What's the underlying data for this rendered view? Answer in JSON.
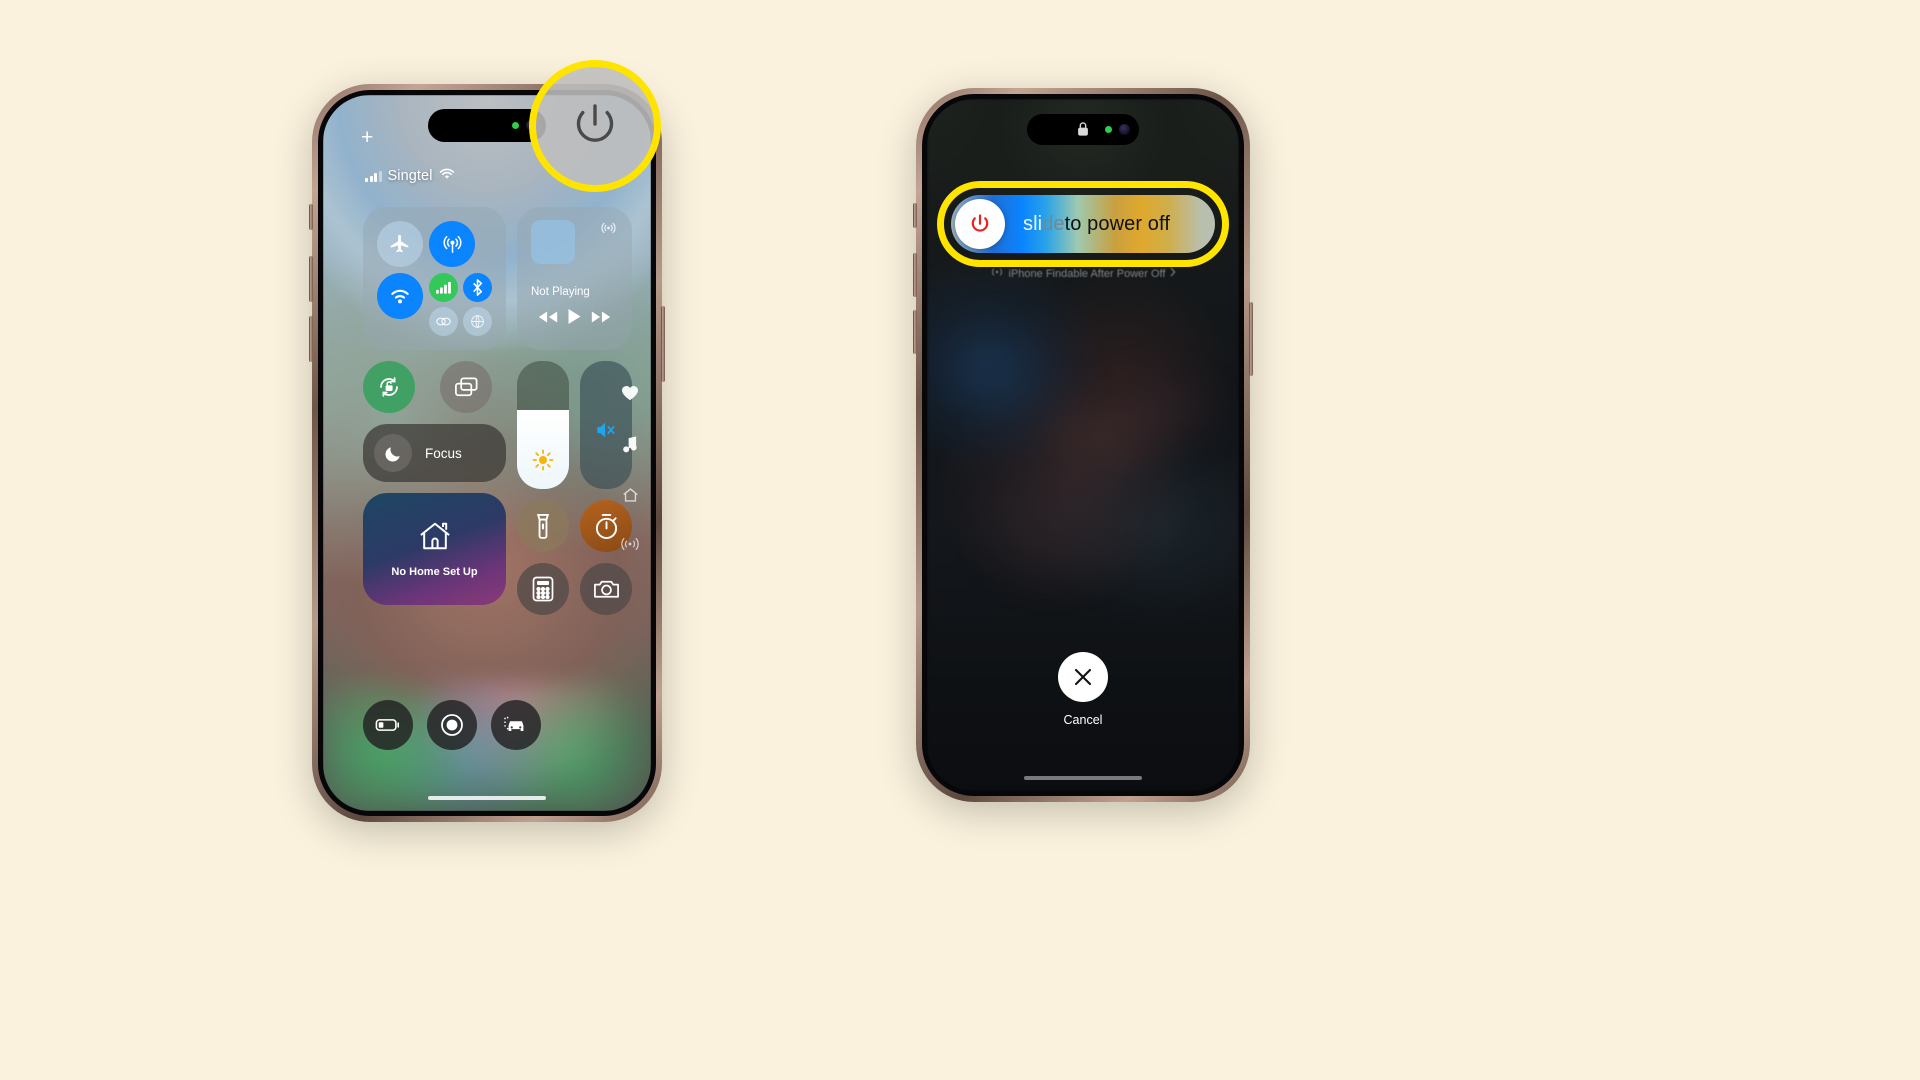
{
  "background_color": "#faf2dd",
  "highlight_color": "#ffe400",
  "phone1": {
    "name": "iphone-control-center",
    "status_bar": {
      "carrier": "Singtel",
      "signal_icon": "cellular-bars-icon",
      "wifi_icon": "wifi-icon"
    },
    "add_widget_icon": "plus-icon",
    "connectivity": {
      "airplane_label": "airplane-mode-toggle",
      "airdrop_label": "airdrop-toggle",
      "wifi_label": "wifi-toggle",
      "cellular_label": "cellular-data-toggle",
      "bluetooth_label": "bluetooth-toggle",
      "vpn_label": "vpn-toggle",
      "hotspot_label": "personal-hotspot-toggle",
      "airplane_active": false,
      "airdrop_active": true,
      "wifi_active": true,
      "cellular_active": true,
      "bluetooth_active": true
    },
    "media": {
      "title": "Not Playing",
      "rewind_icon": "rewind-icon",
      "play_icon": "play-icon",
      "forward_icon": "fast-forward-icon"
    },
    "rotation_lock_label": "rotation-lock-toggle",
    "screen_mirroring_label": "screen-mirroring-button",
    "focus": {
      "label": "Focus",
      "icon": "moon-icon"
    },
    "home": {
      "label": "No Home Set Up",
      "icon": "house-icon"
    },
    "brightness": {
      "icon": "sun-icon",
      "level_percent": 62
    },
    "volume": {
      "icon": "speaker-mute-icon",
      "level_percent": 0
    },
    "shortcuts": {
      "flashlight": "flashlight-icon",
      "timer": "timer-icon",
      "calculator": "calculator-icon",
      "camera": "camera-icon"
    },
    "bottom_row": {
      "low_power": "battery-low-power-icon",
      "screen_record": "screen-record-icon",
      "car": "car-parking-icon"
    },
    "right_rail": {
      "heart": "heart-icon",
      "music": "music-note-icon",
      "home": "home-small-icon",
      "broadcast": "broadcast-icon"
    },
    "power_button_highlight": "power-button-highlight"
  },
  "phone2": {
    "name": "iphone-power-off-screen",
    "lock_icon": "lock-icon",
    "slider": {
      "text_parts": [
        "sli",
        "de",
        " to power off"
      ],
      "full_text": "slide to power off",
      "knob_icon": "power-icon",
      "knob_icon_color": "#e8221f"
    },
    "findable_text": "iPhone Findable After Power Off",
    "findable_icon": "findmy-waves-icon",
    "findable_chevron": "chevron-right-icon",
    "cancel": {
      "label": "Cancel",
      "icon": "close-x-icon"
    }
  }
}
